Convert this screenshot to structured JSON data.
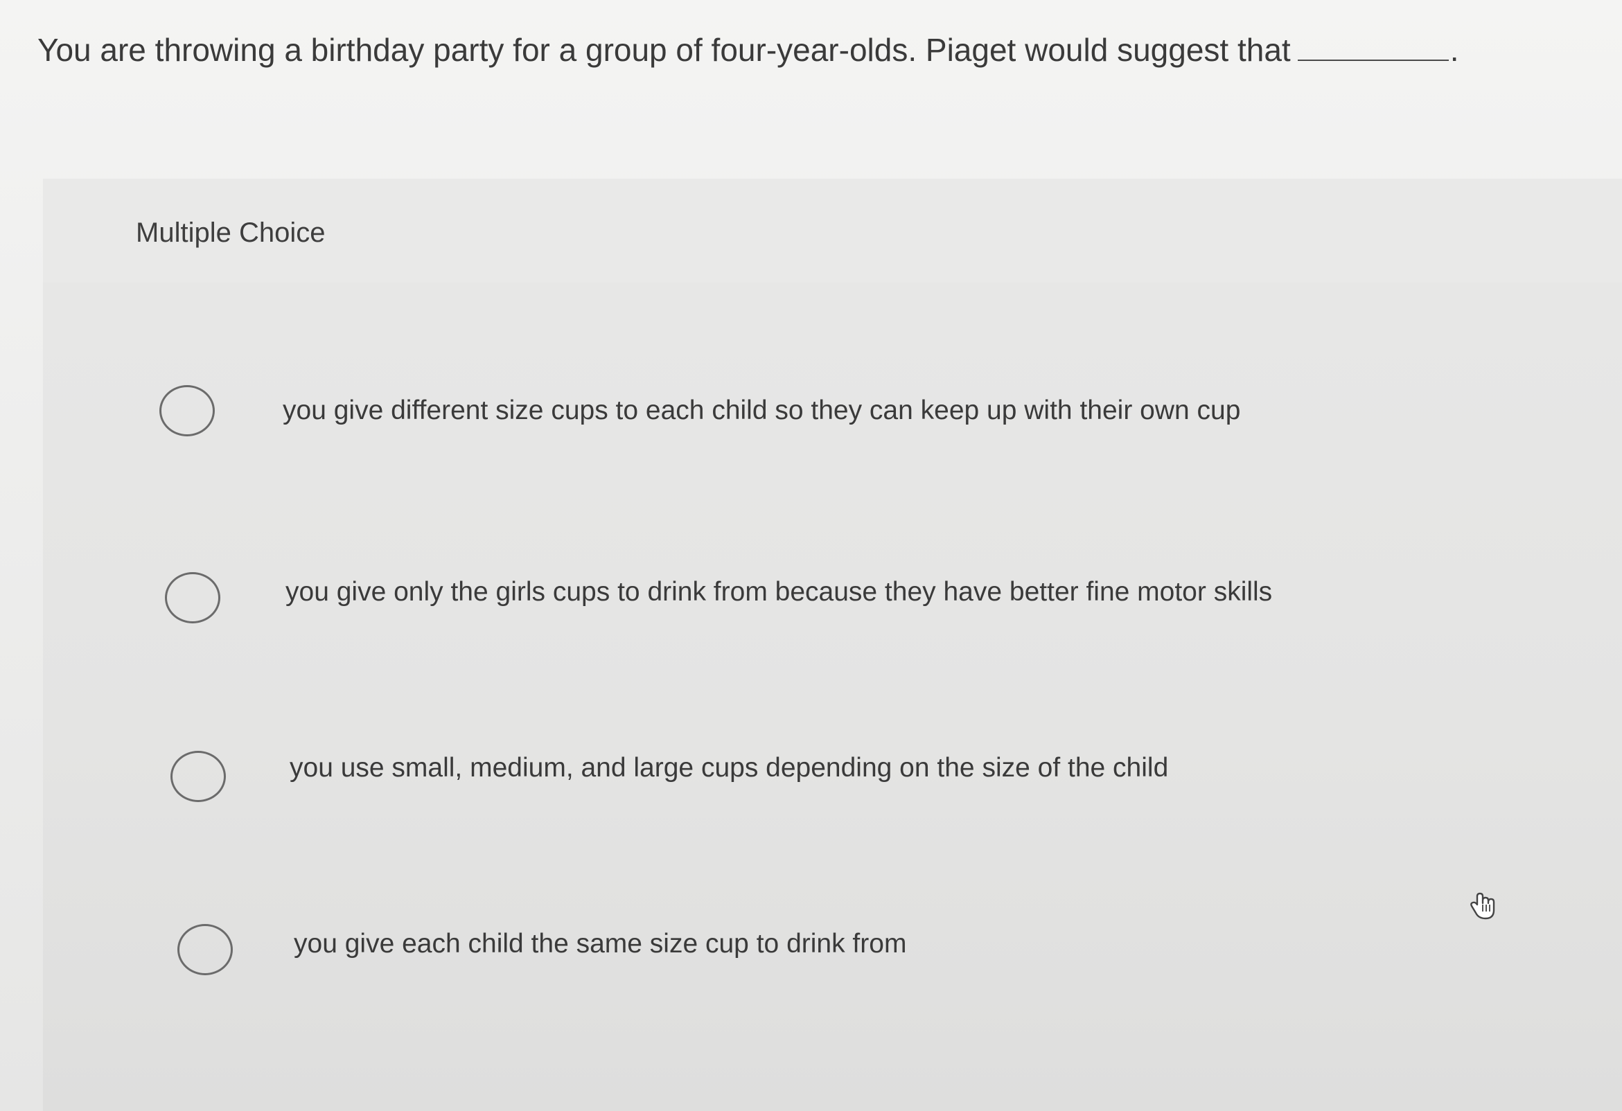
{
  "question": {
    "text": "You are throwing a birthday party for a group of four-year-olds. Piaget would suggest that",
    "end_punct": "."
  },
  "section_label": "Multiple Choice",
  "options": [
    {
      "label": "you give different size cups to each child so they can keep up with their own cup"
    },
    {
      "label": "you give only the girls cups to drink from because they have better fine motor skills"
    },
    {
      "label": "you use small, medium, and large cups depending on the size of the child"
    },
    {
      "label": "you give each child the same size cup to drink from"
    }
  ]
}
